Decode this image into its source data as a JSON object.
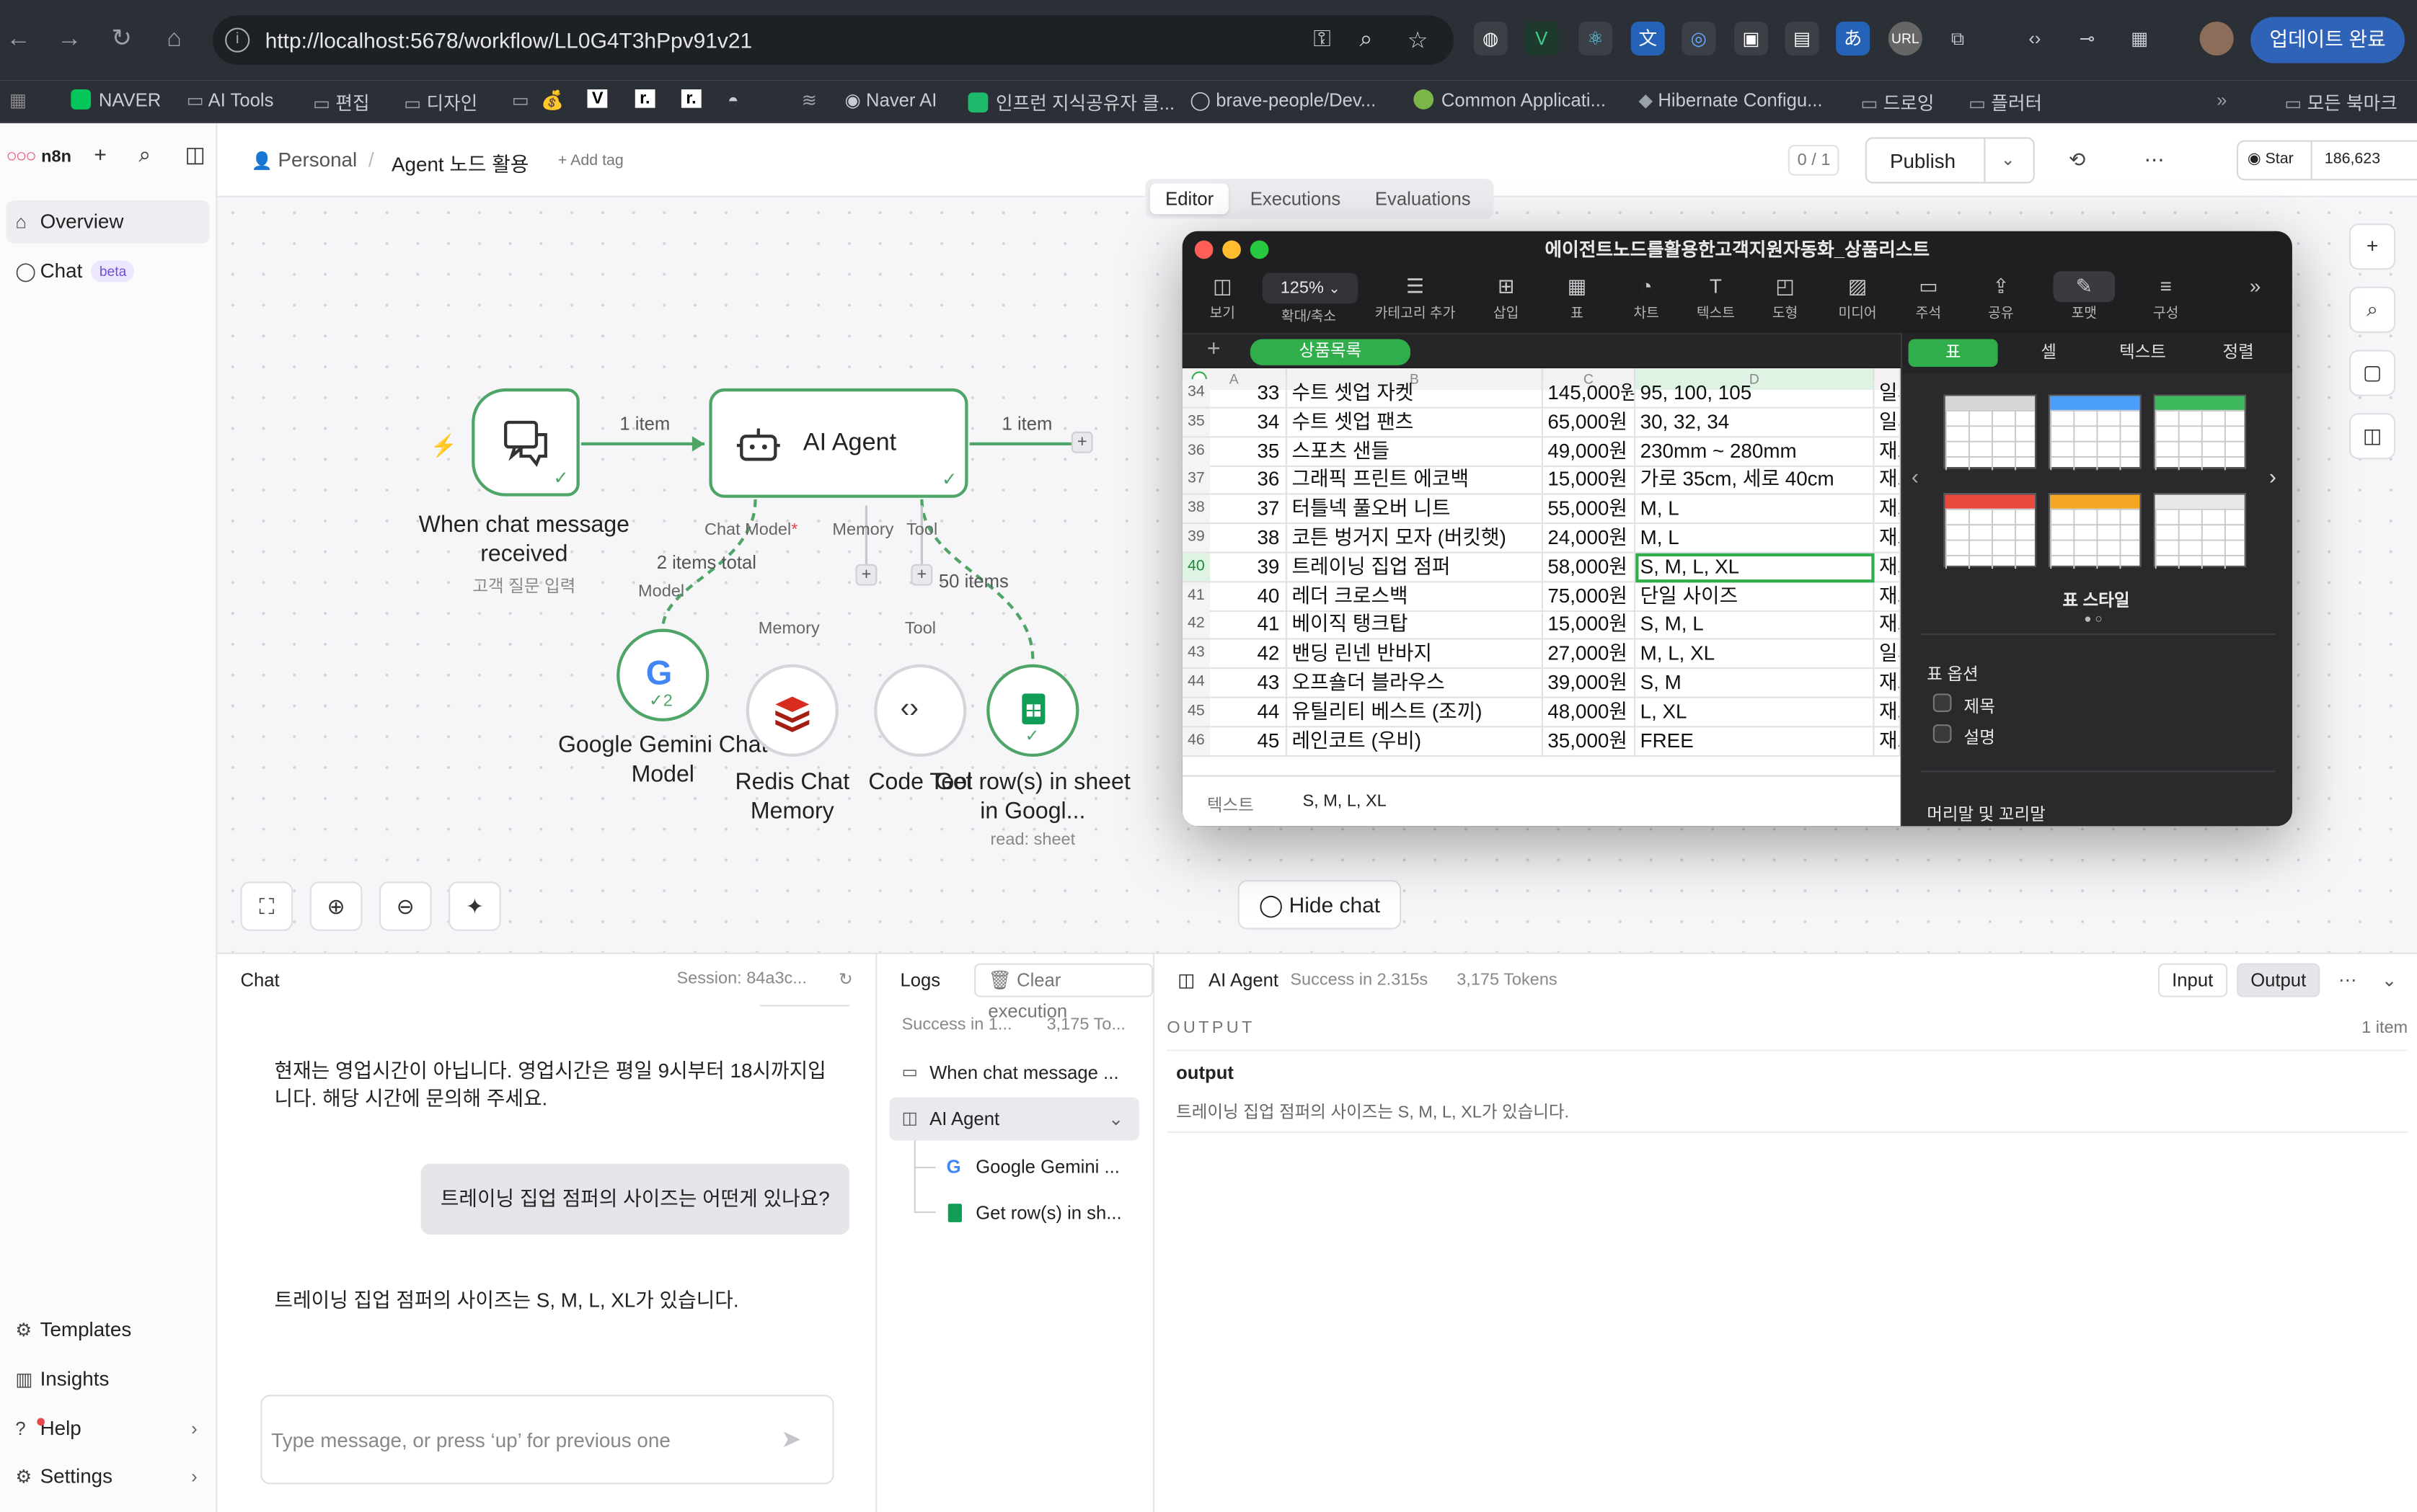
{
  "browser": {
    "url": "http://localhost:5678/workflow/LL0G4T3hPpv91v21",
    "update_button": "업데이트 완료",
    "bookmarks": [
      {
        "label": "NAVER",
        "color": "#03c75a"
      },
      {
        "label": "AI Tools",
        "color": "#8a8f98"
      },
      {
        "label": "편집",
        "color": "#8a8f98"
      },
      {
        "label": "디자인",
        "color": "#8a8f98"
      },
      {
        "label": "Naver AI",
        "color": "#9aa0a8"
      },
      {
        "label": "인프런 지식공유자 클...",
        "color": "#1fb96c"
      },
      {
        "label": "brave-people/Dev...",
        "color": "#cccccc"
      },
      {
        "label": "Common Applicati...",
        "color": "#7ab648"
      },
      {
        "label": "Hibernate Configu...",
        "color": "#8a8f98"
      },
      {
        "label": "드로잉",
        "color": "#8a8f98"
      },
      {
        "label": "플러터",
        "color": "#8a8f98"
      }
    ],
    "bookmark_other": "모든 북마크"
  },
  "sidebar": {
    "logo": "n8n",
    "top_items": [
      {
        "label": "Overview",
        "icon": "home-icon"
      },
      {
        "label": "Chat",
        "icon": "chat-icon",
        "badge": "beta"
      }
    ],
    "bottom_items": [
      {
        "label": "Templates",
        "icon": "templates-icon"
      },
      {
        "label": "Insights",
        "icon": "insights-icon"
      },
      {
        "label": "Help",
        "icon": "help-icon"
      },
      {
        "label": "Settings",
        "icon": "settings-icon"
      }
    ]
  },
  "header": {
    "project": "Personal",
    "workflow_name": "Agent 노드 활용",
    "add_tag": "+ Add tag",
    "counter": "0 / 1",
    "publish": "Publish",
    "github_star": "Star",
    "github_count": "186,623",
    "tabs": [
      "Editor",
      "Executions",
      "Evaluations"
    ]
  },
  "canvas": {
    "trigger": {
      "title": "When chat message received",
      "subtitle": "고객 질문 입력"
    },
    "agent": {
      "title": "AI Agent"
    },
    "edges": {
      "left": "1 item",
      "right": "1 item"
    },
    "ports": {
      "chat_model": "Chat Model",
      "chat_model_required": "*",
      "memory": "Memory",
      "tool": "Tool"
    },
    "edge_labels": {
      "model_items": "2 items total",
      "tool_items": "50 items"
    },
    "subs": [
      {
        "title": "Google Gemini Chat Model",
        "port": "Model",
        "badge": "2"
      },
      {
        "title": "Redis Chat Memory",
        "port": "Memory"
      },
      {
        "title": "Code Tool",
        "port": "Tool"
      },
      {
        "title": "Get row(s) in sheet in Googl...",
        "sub": "read: sheet"
      }
    ],
    "hide_chat": "Hide chat"
  },
  "numbers": {
    "title": "에이전트노드를활용한고객지원자동화_상품리스트",
    "zoom": "125%",
    "toolbar": [
      "보기",
      "확대/축소",
      "카테고리 추가",
      "삽입",
      "표",
      "차트",
      "텍스트",
      "도형",
      "미디어",
      "주석",
      "공유",
      "포맷",
      "구성"
    ],
    "sheet_tab": "상품목록",
    "columns": [
      "A",
      "B",
      "C",
      "D"
    ],
    "rows": [
      {
        "n": "34",
        "id": "33",
        "name": "수트 셋업 자켓",
        "price": "145,000원",
        "size": "95, 100, 105",
        "e": "일시"
      },
      {
        "n": "35",
        "id": "34",
        "name": "수트 셋업 팬츠",
        "price": "65,000원",
        "size": "30, 32, 34",
        "e": "일시"
      },
      {
        "n": "36",
        "id": "35",
        "name": "스포츠 샌들",
        "price": "49,000원",
        "size": "230mm ~ 280mm",
        "e": "재고"
      },
      {
        "n": "37",
        "id": "36",
        "name": "그래픽 프린트 에코백",
        "price": "15,000원",
        "size": "가로 35cm, 세로 40cm",
        "e": "재고"
      },
      {
        "n": "38",
        "id": "37",
        "name": "터틀넥 풀오버 니트",
        "price": "55,000원",
        "size": "M, L",
        "e": "재고"
      },
      {
        "n": "39",
        "id": "38",
        "name": "코튼 벙거지 모자 (버킷햇)",
        "price": "24,000원",
        "size": "M, L",
        "e": "재고"
      },
      {
        "n": "40",
        "id": "39",
        "name": "트레이닝 집업 점퍼",
        "price": "58,000원",
        "size": "S, M, L, XL",
        "e": "재고"
      },
      {
        "n": "41",
        "id": "40",
        "name": "레더 크로스백",
        "price": "75,000원",
        "size": "단일 사이즈",
        "e": "재고"
      },
      {
        "n": "42",
        "id": "41",
        "name": "베이직 탱크탑",
        "price": "15,000원",
        "size": "S, M, L",
        "e": "재고"
      },
      {
        "n": "43",
        "id": "42",
        "name": "밴딩 린넨 반바지",
        "price": "27,000원",
        "size": "M, L, XL",
        "e": "일시"
      },
      {
        "n": "44",
        "id": "43",
        "name": "오프숄더 블라우스",
        "price": "39,000원",
        "size": "S, M",
        "e": "재고"
      },
      {
        "n": "45",
        "id": "44",
        "name": "유틸리티 베스트 (조끼)",
        "price": "48,000원",
        "size": "L, XL",
        "e": "재고"
      },
      {
        "n": "46",
        "id": "45",
        "name": "레인코트 (우비)",
        "price": "35,000원",
        "size": "FREE",
        "e": "재고"
      }
    ],
    "formula_label": "텍스트",
    "formula_value": "S, M, L, XL",
    "panel_tabs": [
      "표",
      "셀",
      "텍스트",
      "정렬"
    ],
    "table_style_label": "표 스타일",
    "table_options_label": "표 옵션",
    "options": [
      "제목",
      "설명"
    ],
    "header_footer_label": "머리말 및 꼬리말"
  },
  "chat": {
    "title": "Chat",
    "session": "Session: 84a3c...",
    "messages": {
      "bot1": "현재는 영업시간이 아닙니다. 영업시간은 평일 9시부터 18시까지입니다. 해당 시간에 문의해 주세요.",
      "user": "트레이닝 집업 점퍼의 사이즈는 어떤게 있나요?",
      "bot2": "트레이닝 집업 점퍼의 사이즈는 S, M, L, XL가 있습니다."
    },
    "placeholder": "Type message, or press ‘up’ for previous one"
  },
  "logs": {
    "title": "Logs",
    "clear": "Clear execution",
    "summary_status": "Success in 1...",
    "summary_tokens": "3,175 To...",
    "items": [
      "When chat message ...",
      "AI Agent"
    ],
    "children": [
      "Google Gemini ...",
      "Get row(s) in sh..."
    ]
  },
  "output": {
    "node": "AI Agent",
    "status": "Success in 2.315s",
    "tokens": "3,175 Tokens",
    "input_btn": "Input",
    "output_btn": "Output",
    "heading": "OUTPUT",
    "count": "1 item",
    "field": "output",
    "value": "트레이닝 집업 점퍼의 사이즈는 S, M, L, XL가 있습니다."
  },
  "colors": {
    "n8n_pink": "#ea4b71",
    "node_green": "#4ea567",
    "numbers_green": "#2fae4b"
  }
}
